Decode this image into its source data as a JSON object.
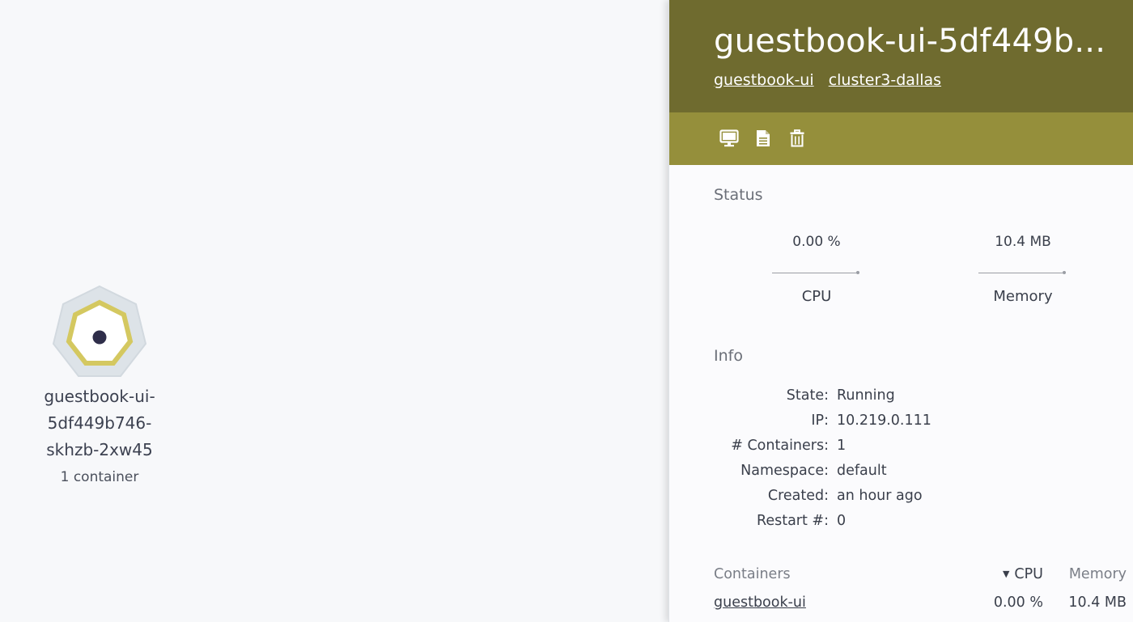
{
  "node": {
    "name": "guestbook-ui-5df449b746-skhzb-2xw45",
    "name_lines": [
      "guestbook-ui-",
      "5df449b746-",
      "skhzb-2xw45"
    ],
    "subtitle": "1 container",
    "ring_color": "#d4c860",
    "halo_color": "#dde3e8",
    "dot_color": "#2f2e4a"
  },
  "panel": {
    "title": "guestbook-ui-5df449b...",
    "links": [
      "guestbook-ui",
      "cluster3-dallas"
    ],
    "header_color": "#6f6b2f",
    "toolbar_color": "#958f3b",
    "toolbar_icons": [
      "monitor-icon",
      "document-icon",
      "trash-icon"
    ]
  },
  "status": {
    "title": "Status",
    "cpu_value": "0.00 %",
    "cpu_label": "CPU",
    "memory_value": "10.4 MB",
    "memory_label": "Memory"
  },
  "info": {
    "title": "Info",
    "rows": [
      {
        "key": "State:",
        "value": "Running"
      },
      {
        "key": "IP:",
        "value": "10.219.0.111"
      },
      {
        "key": "# Containers:",
        "value": "1"
      },
      {
        "key": "Namespace:",
        "value": "default"
      },
      {
        "key": "Created:",
        "value": "an hour ago"
      },
      {
        "key": "Restart #:",
        "value": "0"
      }
    ]
  },
  "containers": {
    "header": "Containers",
    "col_cpu": "CPU",
    "col_memory": "Memory",
    "rows": [
      {
        "name": "guestbook-ui",
        "cpu": "0.00 %",
        "memory": "10.4 MB"
      }
    ]
  }
}
